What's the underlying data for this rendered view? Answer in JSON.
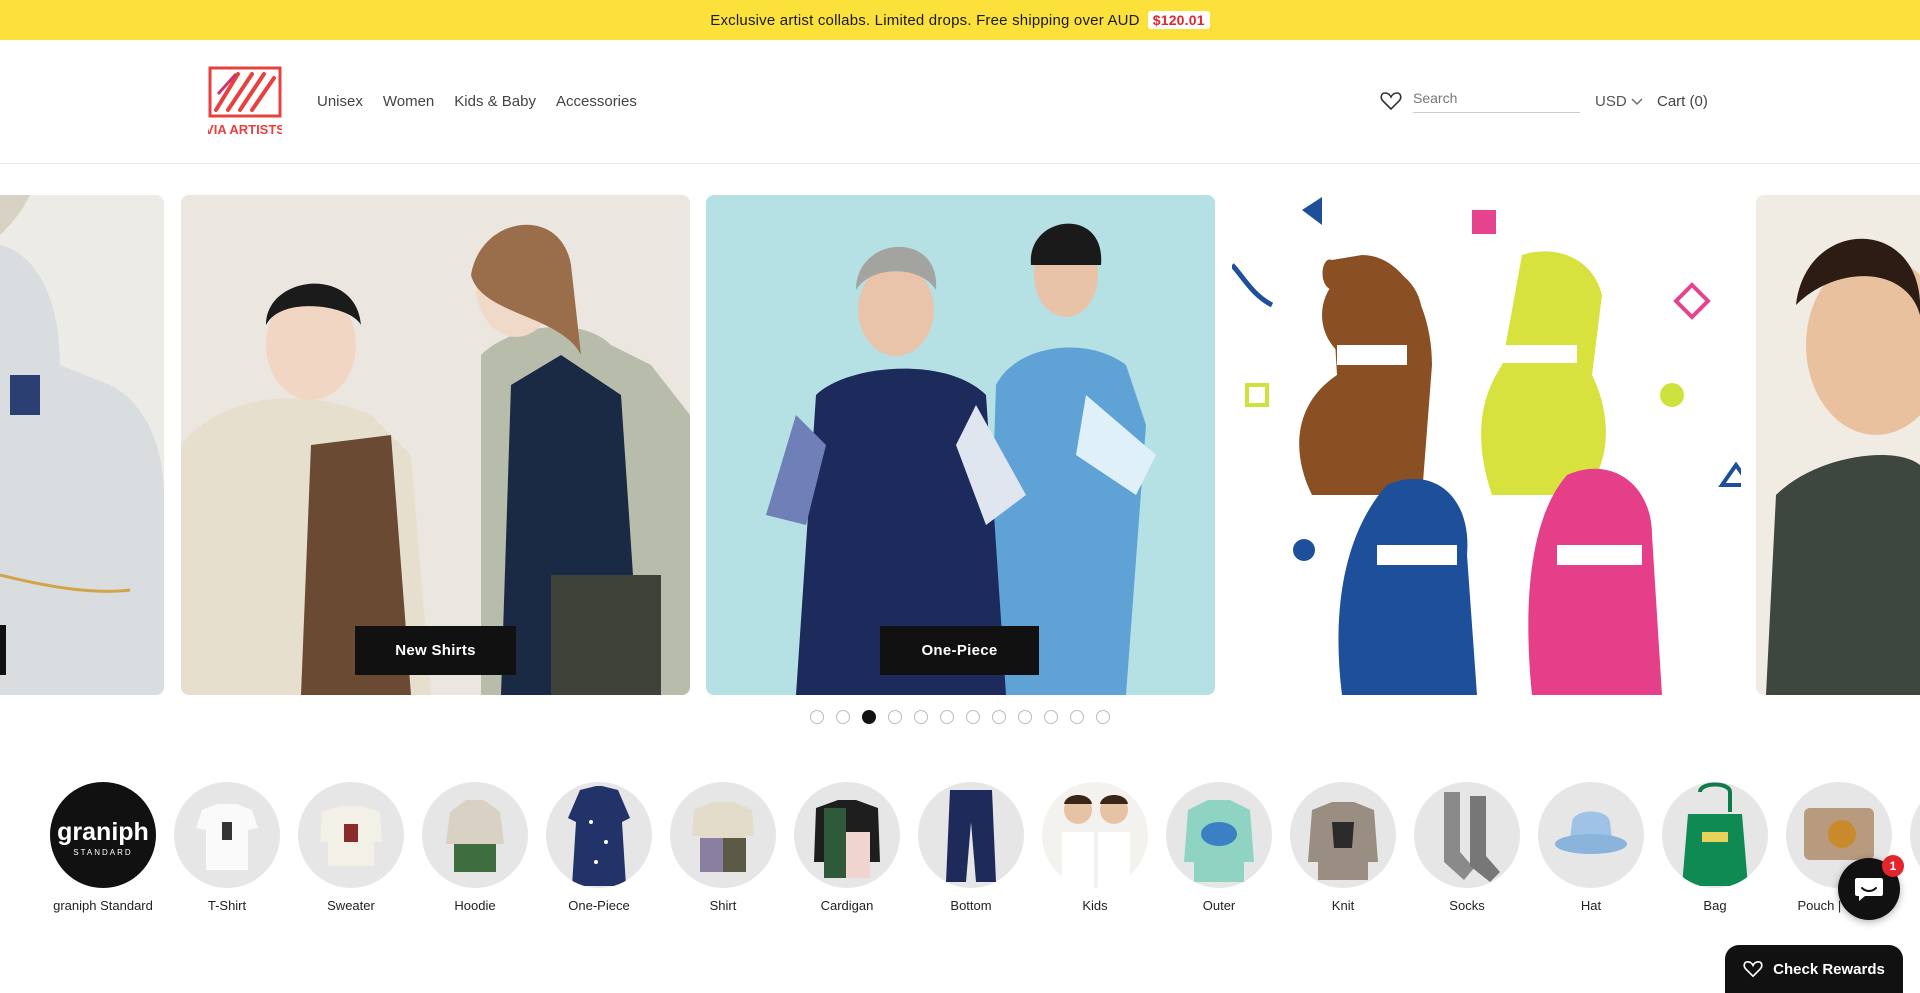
{
  "announcement": {
    "text": "Exclusive artist collabs. Limited drops. Free shipping over AUD",
    "price": "$120.01"
  },
  "brand": {
    "logo_text": "VIA ARTISTS",
    "accent": "#e8403f"
  },
  "nav": [
    "Unisex",
    "Women",
    "Kids & Baby",
    "Accessories"
  ],
  "header": {
    "search_placeholder": "Search",
    "currency": "USD",
    "cart": "Cart (0)"
  },
  "slides": [
    {
      "caption": ""
    },
    {
      "caption": "New Shirts"
    },
    {
      "caption": "One-Piece"
    },
    {
      "caption": ""
    },
    {
      "caption": ""
    }
  ],
  "slider_dots": {
    "count": 12,
    "active_index": 2
  },
  "categories": [
    "graniph Standard",
    "T-Shirt",
    "Sweater",
    "Hoodie",
    "One-Piece",
    "Shirt",
    "Cardigan",
    "Bottom",
    "Kids",
    "Outer",
    "Knit",
    "Socks",
    "Hat",
    "Bag",
    "Pouch | Wallet"
  ],
  "graniph_logo": {
    "main": "graniph",
    "sub": "STANDARD"
  },
  "chat": {
    "badge": "1"
  },
  "rewards": {
    "label": "Check Rewards"
  },
  "colors": {
    "announcement_bg": "#fbe13a",
    "price_red": "#e3262f"
  }
}
